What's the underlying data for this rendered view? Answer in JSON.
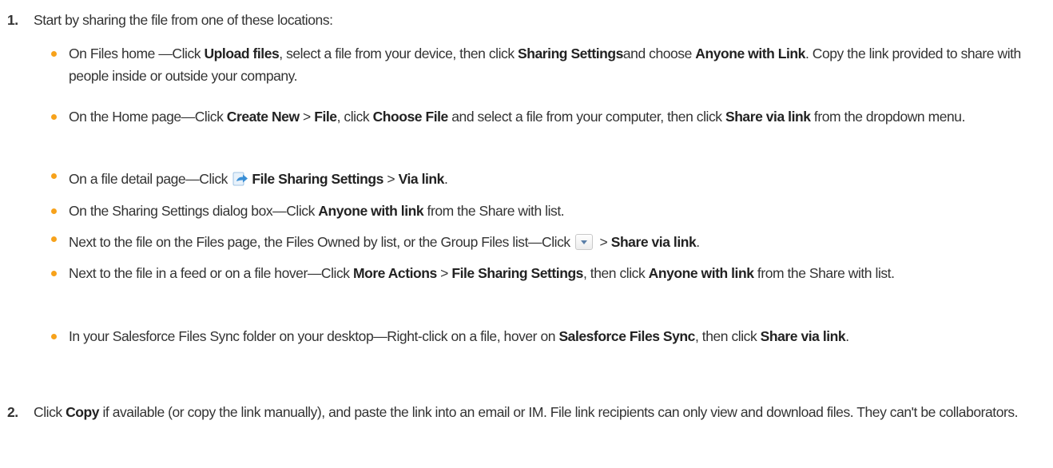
{
  "steps": [
    {
      "number": "1.",
      "text": "Start by sharing the file from one of these locations:"
    },
    {
      "number": "2.",
      "t1": "Click ",
      "b1": "Copy",
      "t2": " if available (or copy the link manually), and paste the link into an email or IM. File link recipients can only view and download files. They can't be collaborators."
    }
  ],
  "bullets": [
    {
      "t1": "On Files home —Click ",
      "b1": "Upload files",
      "t2": ", select a file from your device, then click ",
      "b2": "Sharing Settings",
      "t3": "and choose ",
      "b3": "Anyone with Link",
      "t4": ". Copy the link provided to share with people inside or outside your company."
    },
    {
      "t1": "On the Home page—Click ",
      "b1": "Create New",
      "t2": " > ",
      "b2": "File",
      "t3": ", click ",
      "b3": "Choose File",
      "t4": " and select a file from your computer, then click ",
      "b4": "Share via link",
      "t5": " from the dropdown menu."
    },
    {
      "t1": "On a file detail page—Click ",
      "icon": "file-share-icon",
      "b1": "File Sharing Settings",
      "t2": " > ",
      "b2": "Via link",
      "t3": "."
    },
    {
      "t1": "On the Sharing Settings dialog box—Click ",
      "b1": "Anyone with link",
      "t2": " from the Share with list."
    },
    {
      "t1": "Next to the file on the Files page, the Files Owned by list, or the Group Files list—Click ",
      "icon": "dropdown-arrow-icon",
      "t2": " > ",
      "b1": "Share via link",
      "t3": "."
    },
    {
      "t1": "Next to the file in a feed or on a file hover—Click ",
      "b1": "More Actions",
      "t2": " > ",
      "b2": "File Sharing Settings",
      "t3": ", then click ",
      "b3": "Anyone with link",
      "t4": " from the Share with list."
    },
    {
      "t1": "In your Salesforce Files Sync folder on your desktop—Right-click on a file, hover on ",
      "b1": "Salesforce Files Sync",
      "t2": ", then click ",
      "b2": "Share via link",
      "t3": "."
    }
  ],
  "colors": {
    "bullet": "#f7a21b",
    "text": "#333333"
  }
}
